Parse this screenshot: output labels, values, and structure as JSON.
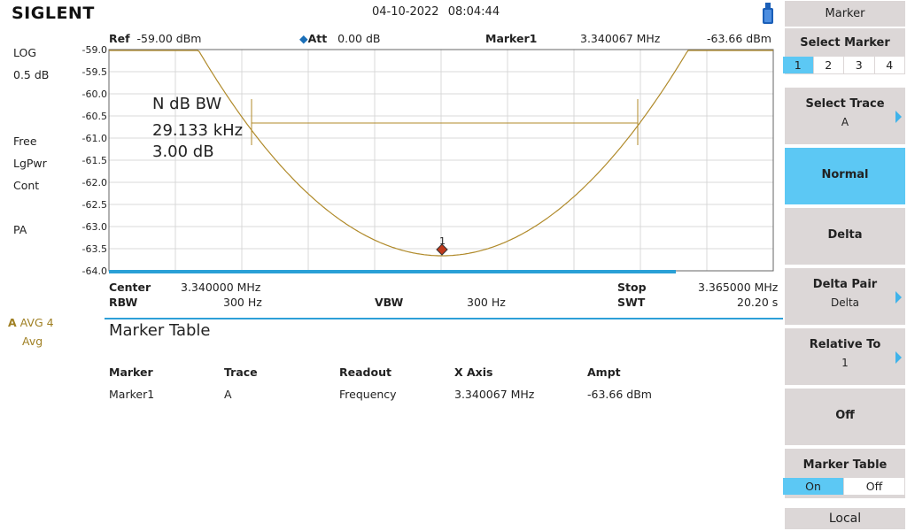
{
  "header": {
    "brand": "SIGLENT",
    "date": "04-10-2022",
    "time": "08:04:44"
  },
  "left_status": {
    "scale_type": "LOG",
    "scale_div": "0.5 dB",
    "trig": "Free",
    "det": "LgPwr",
    "sweep": "Cont",
    "preamp": "PA",
    "avg_letter": "A",
    "avg_label": "AVG 4",
    "avg_mode": "Avg"
  },
  "readouts": {
    "ref_label": "Ref",
    "ref_value": "-59.00 dBm",
    "att_label": "Att",
    "att_value": "0.00 dB",
    "marker_name": "Marker1",
    "marker_freq": "3.340067 MHz",
    "marker_ampl": "-63.66 dBm"
  },
  "annotation": {
    "line1": "N dB BW",
    "line2": "29.133 kHz",
    "line3": "3.00 dB",
    "marker_num": "1"
  },
  "y_ticks": [
    "-59.0",
    "-59.5",
    "-60.0",
    "-60.5",
    "-61.0",
    "-61.5",
    "-62.0",
    "-62.5",
    "-63.0",
    "-63.5",
    "-64.0"
  ],
  "params": {
    "center_label": "Center",
    "center_value": "3.340000 MHz",
    "stop_label": "Stop",
    "stop_value": "3.365000 MHz",
    "rbw_label": "RBW",
    "rbw_value": "300 Hz",
    "vbw_label": "VBW",
    "vbw_value": "300 Hz",
    "swt_label": "SWT",
    "swt_value": "20.20 s"
  },
  "marker_table": {
    "title": "Marker Table",
    "headers": [
      "Marker",
      "Trace",
      "Readout",
      "X Axis",
      "Ampt"
    ],
    "rows": [
      [
        "Marker1",
        "A",
        "Frequency",
        "3.340067 MHz",
        "-63.66 dBm"
      ]
    ]
  },
  "menu": {
    "title": "Marker",
    "select_marker": {
      "label": "Select Marker",
      "options": [
        "1",
        "2",
        "3",
        "4"
      ],
      "selected": "1"
    },
    "select_trace": {
      "label": "Select Trace",
      "value": "A"
    },
    "normal": "Normal",
    "delta": "Delta",
    "delta_pair": {
      "label": "Delta Pair",
      "value": "Delta"
    },
    "relative_to": {
      "label": "Relative To",
      "value": "1"
    },
    "off": "Off",
    "marker_table": {
      "label": "Marker Table",
      "on": "On",
      "off": "Off"
    },
    "local": "Local"
  },
  "colors": {
    "trace": "#b08a2a",
    "accent": "#5cc8f4",
    "panel": "#dcd7d7",
    "marker": "#c0391b"
  }
}
